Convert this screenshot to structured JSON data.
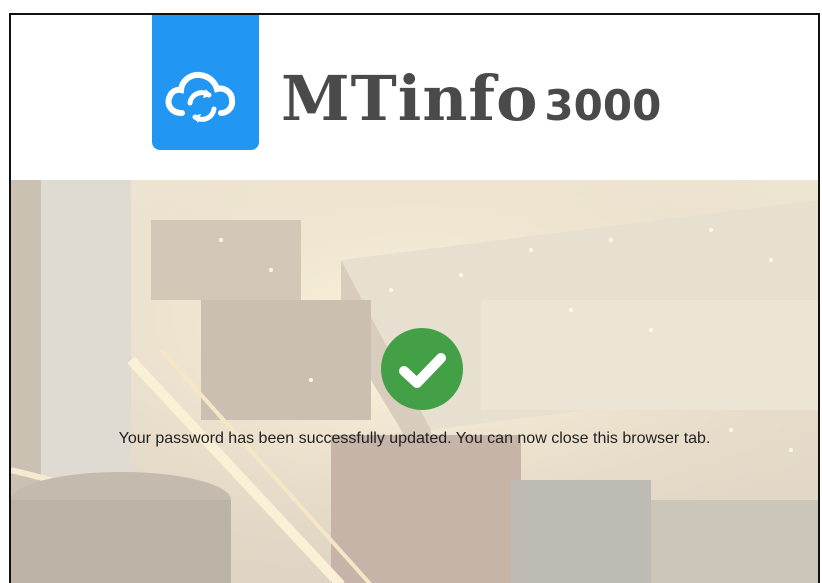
{
  "header": {
    "logo_icon": "cloud-sync-icon",
    "brand_name": "MTinfo",
    "brand_number": "3000",
    "brand_color": "#2196f3"
  },
  "status": {
    "icon": "check-circle-icon",
    "icon_color": "#43a047",
    "message": "Your password has been successfully updated. You can now close this browser tab."
  }
}
